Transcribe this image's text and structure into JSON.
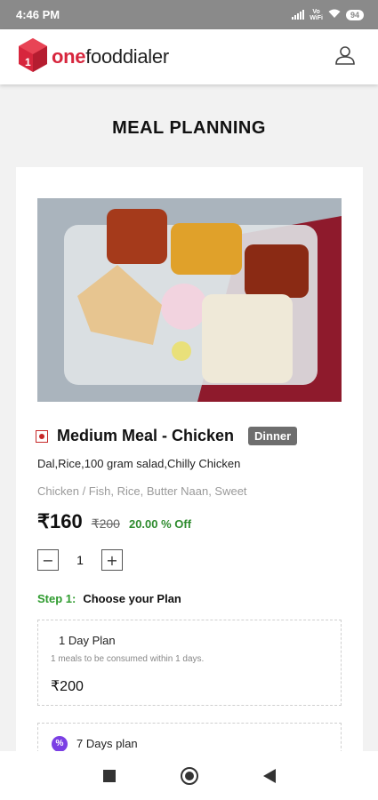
{
  "status_bar": {
    "time": "4:46 PM",
    "network_label": "Vo\nWiFi",
    "battery": "94"
  },
  "app_bar": {
    "brand_one": "one",
    "brand_rest": "fooddialer",
    "logo_icon": "cube-logo-icon",
    "profile_icon": "user-icon",
    "brand_color": "#d7263d"
  },
  "page": {
    "title": "MEAL PLANNING"
  },
  "meal": {
    "image_desc": "meal-tray-image",
    "name": "Medium Meal - Chicken",
    "badge": "Dinner",
    "diet_icon": "non-veg-indicator-icon",
    "items": "Dal,Rice,100 gram salad,Chilly Chicken",
    "tags": "Chicken / Fish, Rice, Butter Naan, Sweet",
    "price": "₹160",
    "mrp": "₹200",
    "discount": "20.00 % Off",
    "quantity": "1",
    "qty_minus": "−",
    "qty_plus": "+"
  },
  "step": {
    "number": "Step 1:",
    "label": "Choose your Plan"
  },
  "plans": [
    {
      "name": "1 Day Plan",
      "desc": "1 meals to be consumed within 1 days.",
      "price": "₹200"
    },
    {
      "name": "7 Days plan",
      "icon": "percent-badge-icon"
    }
  ],
  "nav": {
    "recents": "square-icon",
    "home": "circle-icon",
    "back": "triangle-back-icon"
  },
  "colors": {
    "accent_green": "#2e8b2e",
    "badge_gray": "#6e6e6e",
    "status_bar": "#8a8a8a"
  }
}
